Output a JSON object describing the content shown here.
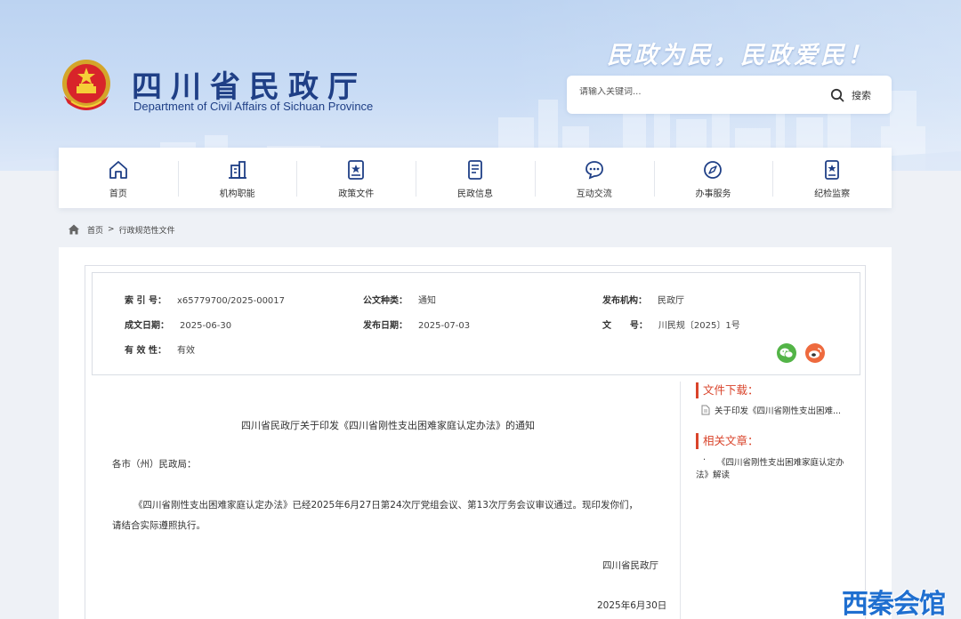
{
  "header": {
    "site_title": "四川省民政厅",
    "site_subtitle": "Department of Civil Affairs of Sichuan Province",
    "slogan": "民政为民，民政爱民！",
    "search": {
      "placeholder": "请输入关键词...",
      "button_label": "搜索"
    }
  },
  "nav": {
    "items": [
      {
        "label": "首页",
        "icon": "home-icon"
      },
      {
        "label": "机构职能",
        "icon": "building-icon"
      },
      {
        "label": "政策文件",
        "icon": "policy-book-icon"
      },
      {
        "label": "民政信息",
        "icon": "document-icon"
      },
      {
        "label": "互动交流",
        "icon": "chat-icon"
      },
      {
        "label": "办事服务",
        "icon": "compass-icon"
      },
      {
        "label": "纪检监察",
        "icon": "badge-icon"
      }
    ]
  },
  "breadcrumb": {
    "home": "首页",
    "separator": ">",
    "current": "行政规范性文件"
  },
  "meta": {
    "index_no_label": "索 引 号：",
    "index_no": "x65779700/2025-00017",
    "doc_type_label": "公文种类：",
    "doc_type": "通知",
    "issuer_label": "发布机构：",
    "issuer": "民政厅",
    "created_label": "成文日期：",
    "created": "2025-06-30",
    "published_label": "发布日期：",
    "published": "2025-07-03",
    "doc_no_label": "文      号：",
    "doc_no": "川民规〔2025〕1号",
    "validity_label": "有 效 性：",
    "validity": "有效"
  },
  "share": {
    "wechat_icon": "wechat-icon",
    "weibo_icon": "weibo-icon"
  },
  "document": {
    "title": "四川省民政厅关于印发《四川省刚性支出困难家庭认定办法》的通知",
    "salutation": "各市（州）民政局：",
    "body_line1": "《四川省刚性支出困难家庭认定办法》已经2025年6月27日第24次厅党组会议、第13次厅务会议审议通过。现印发你们，",
    "body_line2": "请结合实际遵照执行。",
    "signature": "四川省民政厅",
    "date": "2025年6月30日"
  },
  "sidebar": {
    "downloads_title": "文件下载：",
    "download_link": "关于印发《四川省刚性支出困难...",
    "related_title": "相关文章：",
    "related_bullet": "·",
    "related_line1": "《四川省刚性支出困难家庭认定办",
    "related_line2": "法》解读"
  },
  "watermark": "西秦会馆",
  "colors": {
    "brand_blue": "#1f3f86",
    "accent_red": "#d9432a",
    "banner": "#c9dcf5"
  }
}
